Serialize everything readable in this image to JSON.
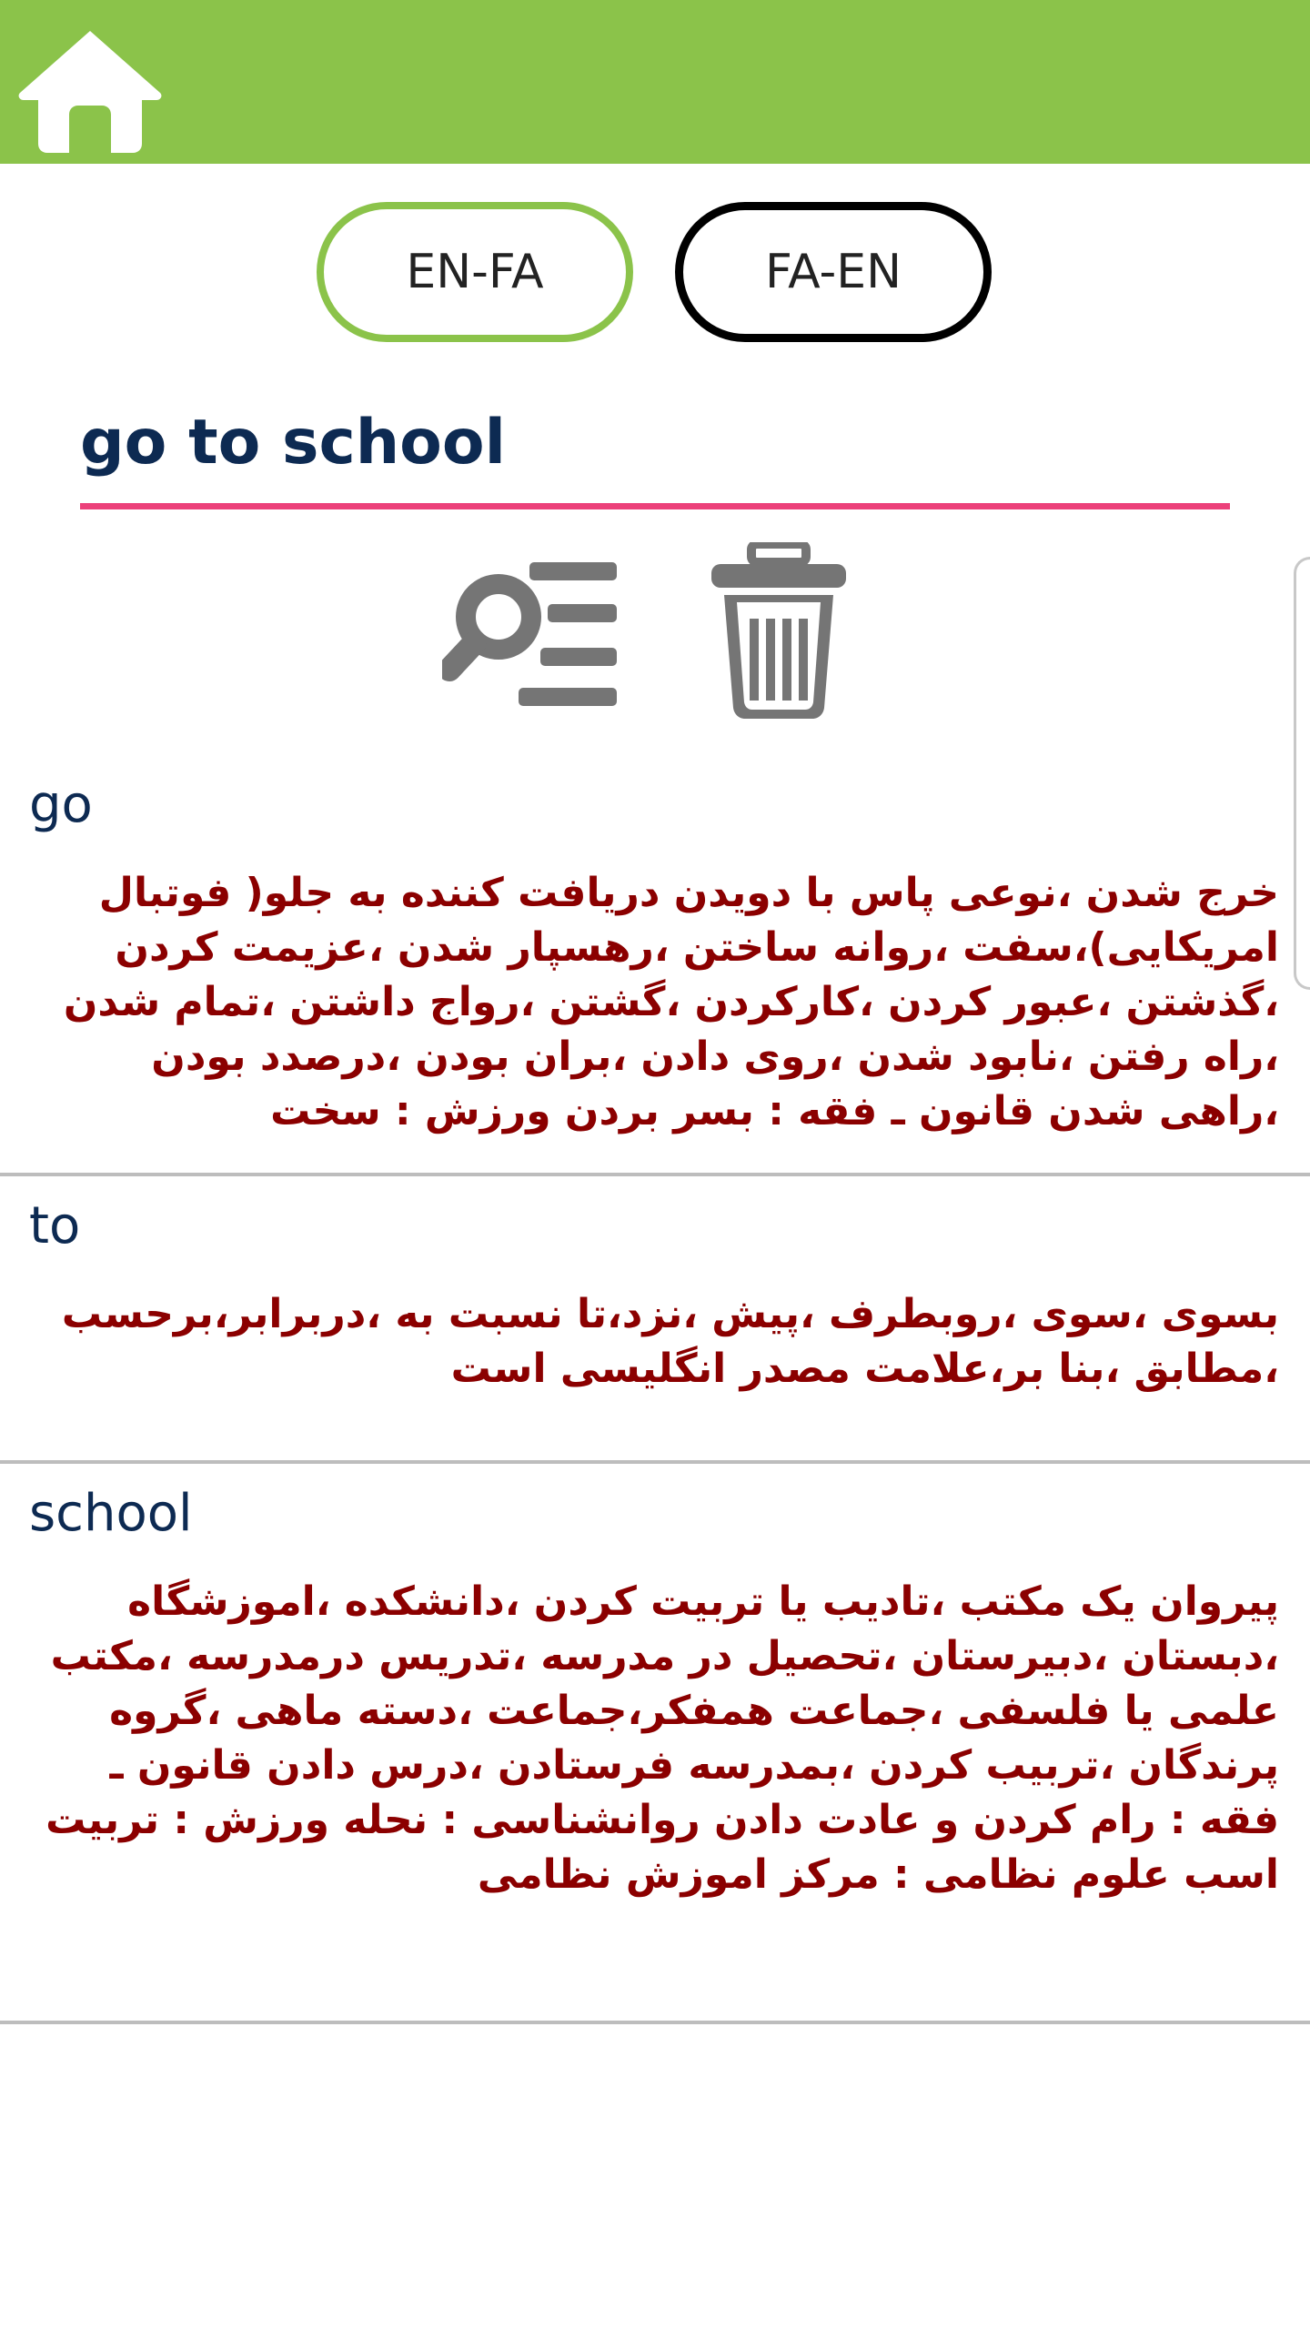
{
  "header": {
    "bg_color": "#8bc34a",
    "home_icon": "home-icon"
  },
  "language": {
    "en_fa_label": "EN-FA",
    "fa_en_label": "FA-EN",
    "selected": "EN-FA",
    "selected_color": "#8bc34a"
  },
  "search": {
    "value": "go to school",
    "underline_color": "#ec407a"
  },
  "actions": {
    "search_icon": "search-list-icon",
    "delete_icon": "trash-icon"
  },
  "results": [
    {
      "word": "go",
      "meaning": "خرج شدن ،نوعی پاس با دویدن دریافت کننده به جلو( فوتبال امریکایی)،سفت ،روانه ساختن ،رهسپار شدن ،عزیمت کردن ،گذشتن ،عبور کردن ،کارکردن ،گشتن ،رواج داشتن ،تمام شدن ،راه رفتن ،نابود شدن ،روی دادن ،بران بودن ،درصدد بودن ،راهی شدن قانون ـ فقه : بسر بردن ورزش : سخت"
    },
    {
      "word": "to",
      "meaning": "بسوی ،سوی ،روبطرف ،پیش ،نزد،تا نسبت به ،دربرابر،برحسب ،مطابق ،بنا بر،علامت مصدر انگلیسی است"
    },
    {
      "word": "school",
      "meaning": "پیروان یک مکتب ،تادیب یا تربیت کردن ،دانشکده ،اموزشگاه ،دبستان ،دبیرستان ،تحصیل در مدرسه ،تدریس درمدرسه ،مکتب علمی یا فلسفی ،جماعت همفکر،جماعت ،دسته ماهی ،گروه پرندگان ،تربیب کردن ،بمدرسه فرستادن ،درس دادن قانون ـ فقه : رام کردن و عادت دادن روانشناسی : نحله ورزش : تربیت اسب علوم نظامی : مرکز اموزش نظامی"
    }
  ],
  "colors": {
    "word_color": "#0d2a52",
    "meaning_color": "#8b0000",
    "divider_color": "#bdbdbd"
  }
}
